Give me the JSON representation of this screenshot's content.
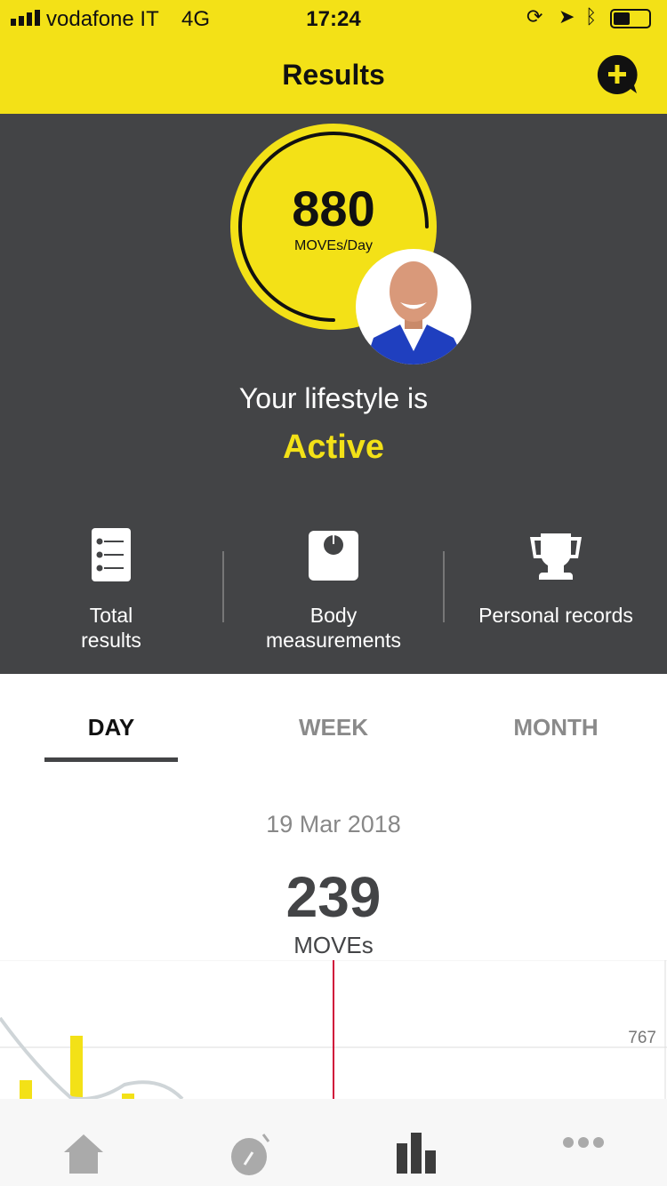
{
  "status_bar": {
    "carrier": "vodafone IT",
    "network": "4G",
    "time": "17:24"
  },
  "header": {
    "title": "Results",
    "add_icon": "plus-circle-icon"
  },
  "score": {
    "value": "880",
    "unit": "MOVEs/Day"
  },
  "lifestyle": {
    "prefix": "Your lifestyle is",
    "level": "Active"
  },
  "shortcuts": [
    {
      "label1": "Total",
      "label2": "results",
      "icon": "list-icon"
    },
    {
      "label1": "Body",
      "label2": "measurements",
      "icon": "scale-icon"
    },
    {
      "label1": "Personal records",
      "label2": "",
      "icon": "trophy-icon"
    }
  ],
  "tabs": [
    {
      "label": "DAY",
      "active": true
    },
    {
      "label": "WEEK"
    },
    {
      "label": "MONTH"
    }
  ],
  "day": {
    "date": "19 Mar 2018",
    "moves": "239",
    "unit": "MOVEs"
  },
  "chart_data": {
    "type": "bar",
    "reference_line_label": "767",
    "colors": {
      "bars": "#f3e117",
      "line": "#cfd5d8",
      "now": "#d0103a"
    }
  },
  "tabbar": [
    {
      "icon": "home-icon"
    },
    {
      "icon": "stopwatch-icon"
    },
    {
      "icon": "bar-chart-icon",
      "active": true
    },
    {
      "icon": "more-icon"
    }
  ],
  "colors": {
    "accent": "#f3e117",
    "dark": "#434446"
  }
}
